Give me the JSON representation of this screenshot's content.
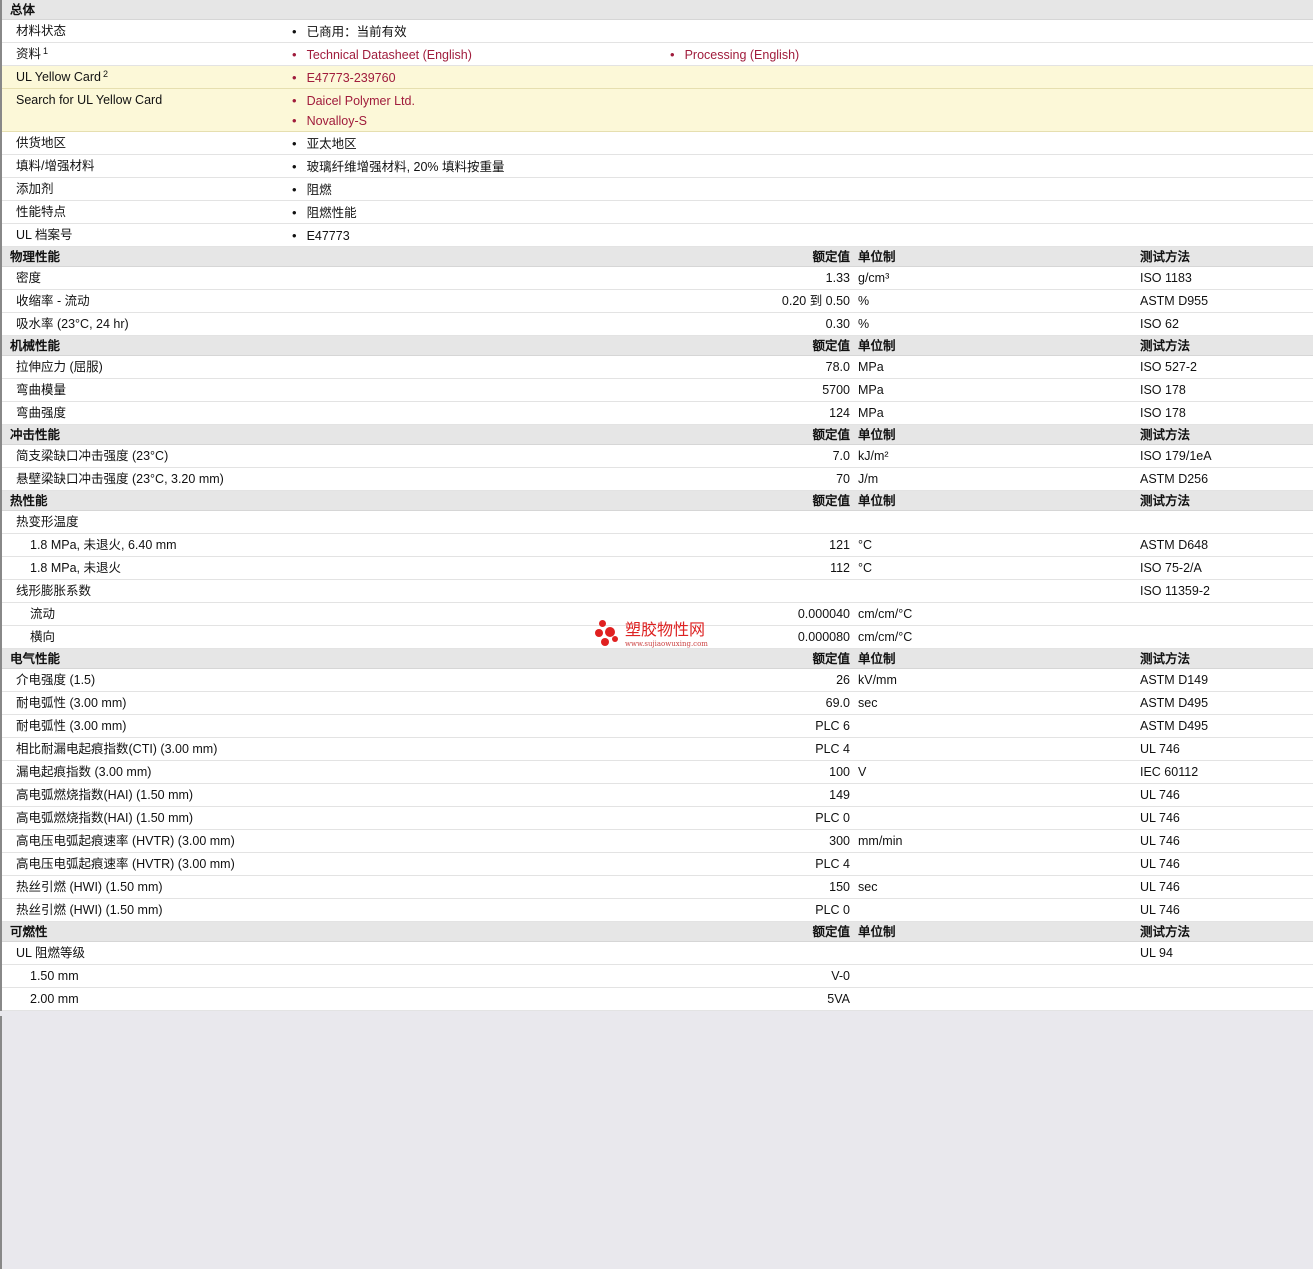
{
  "general": {
    "title": "总体",
    "status_label": "材料状态",
    "status_value": "已商用：当前有效",
    "docs_label": "资料",
    "docs_sup": "1",
    "doc1": "Technical Datasheet (English)",
    "doc2": "Processing (English)",
    "ulcard_label": "UL Yellow Card",
    "ulcard_sup": "2",
    "ulcard_value": "E47773-239760",
    "search_label": "Search for UL Yellow Card",
    "search1": "Daicel Polymer Ltd.",
    "search2": "Novalloy-S",
    "region_label": "供货地区",
    "region_value": "亚太地区",
    "filler_label": "填料/增强材料",
    "filler_value": "玻璃纤维增强材料, 20% 填料按重量",
    "additive_label": "添加剂",
    "additive_value": "阻燃",
    "feature_label": "性能特点",
    "feature_value": "阻燃性能",
    "ulfile_label": "UL 档案号",
    "ulfile_value": "E47773"
  },
  "col_headers": {
    "value": "额定值",
    "unit": "单位制",
    "method": "测试方法"
  },
  "sections": {
    "physical": {
      "title": "物理性能",
      "rows": [
        {
          "label": "密度",
          "value": "1.33",
          "unit": "g/cm³",
          "method": "ISO 1183"
        },
        {
          "label": "收缩率  - 流动",
          "value": "0.20 到  0.50",
          "unit": "%",
          "method": "ASTM D955"
        },
        {
          "label": "吸水率  (23°C, 24 hr)",
          "value": "0.30",
          "unit": "%",
          "method": "ISO 62"
        }
      ]
    },
    "mechanical": {
      "title": "机械性能",
      "rows": [
        {
          "label": "拉伸应力  (屈服)",
          "value": "78.0",
          "unit": "MPa",
          "method": "ISO 527-2"
        },
        {
          "label": "弯曲模量",
          "value": "5700",
          "unit": "MPa",
          "method": "ISO 178"
        },
        {
          "label": "弯曲强度",
          "value": "124",
          "unit": "MPa",
          "method": "ISO 178"
        }
      ]
    },
    "impact": {
      "title": "冲击性能",
      "rows": [
        {
          "label": "简支梁缺口冲击强度  (23°C)",
          "value": "7.0",
          "unit": "kJ/m²",
          "method": "ISO 179/1eA"
        },
        {
          "label": "悬壁梁缺口冲击强度  (23°C, 3.20 mm)",
          "value": "70",
          "unit": "J/m",
          "method": "ASTM D256"
        }
      ]
    },
    "thermal": {
      "title": "热性能",
      "hdt_label": "热变形温度",
      "hdt1": {
        "label": "1.8 MPa, 未退火, 6.40 mm",
        "value": "121",
        "unit": "°C",
        "method": "ASTM D648"
      },
      "hdt2": {
        "label": "1.8 MPa, 未退火",
        "value": "112",
        "unit": "°C",
        "method": "ISO 75-2/A"
      },
      "clte_label": "线形膨胀系数",
      "clte_method": "ISO 11359-2",
      "clte1": {
        "label": "流动",
        "value": "0.000040",
        "unit": "cm/cm/°C"
      },
      "clte2": {
        "label": "横向",
        "value": "0.000080",
        "unit": "cm/cm/°C"
      }
    },
    "electrical": {
      "title": "电气性能",
      "rows": [
        {
          "label": "介电强度  (1.5)",
          "value": "26",
          "unit": "kV/mm",
          "method": "ASTM D149"
        },
        {
          "label": "耐电弧性  (3.00 mm)",
          "value": "69.0",
          "unit": "sec",
          "method": "ASTM D495"
        },
        {
          "label": "耐电弧性  (3.00 mm)",
          "value": "PLC 6",
          "unit": "",
          "method": "ASTM D495"
        },
        {
          "label": "相比耐漏电起痕指数(CTI) (3.00 mm)",
          "value": "PLC 4",
          "unit": "",
          "method": "UL 746"
        },
        {
          "label": "漏电起痕指数  (3.00 mm)",
          "value": "100",
          "unit": "V",
          "method": "IEC 60112"
        },
        {
          "label": "高电弧燃烧指数(HAI) (1.50 mm)",
          "value": "149",
          "unit": "",
          "method": "UL 746"
        },
        {
          "label": "高电弧燃烧指数(HAI) (1.50 mm)",
          "value": "PLC 0",
          "unit": "",
          "method": "UL 746"
        },
        {
          "label": "高电压电弧起痕速率  (HVTR) (3.00 mm)",
          "value": "300",
          "unit": "mm/min",
          "method": "UL 746"
        },
        {
          "label": "高电压电弧起痕速率  (HVTR) (3.00 mm)",
          "value": "PLC 4",
          "unit": "",
          "method": "UL 746"
        },
        {
          "label": "热丝引燃  (HWI) (1.50 mm)",
          "value": "150",
          "unit": "sec",
          "method": "UL 746"
        },
        {
          "label": "热丝引燃  (HWI) (1.50 mm)",
          "value": "PLC 0",
          "unit": "",
          "method": "UL 746"
        }
      ]
    },
    "flammability": {
      "title": "可燃性",
      "ul_label": "UL 阻燃等级",
      "ul_method": "UL 94",
      "r1": {
        "label": "1.50 mm",
        "value": "V-0"
      },
      "r2": {
        "label": "2.00 mm",
        "value": "5VA"
      }
    }
  },
  "watermark": {
    "text": "塑胶物性网",
    "url": "www.sujiaowuxing.com"
  }
}
